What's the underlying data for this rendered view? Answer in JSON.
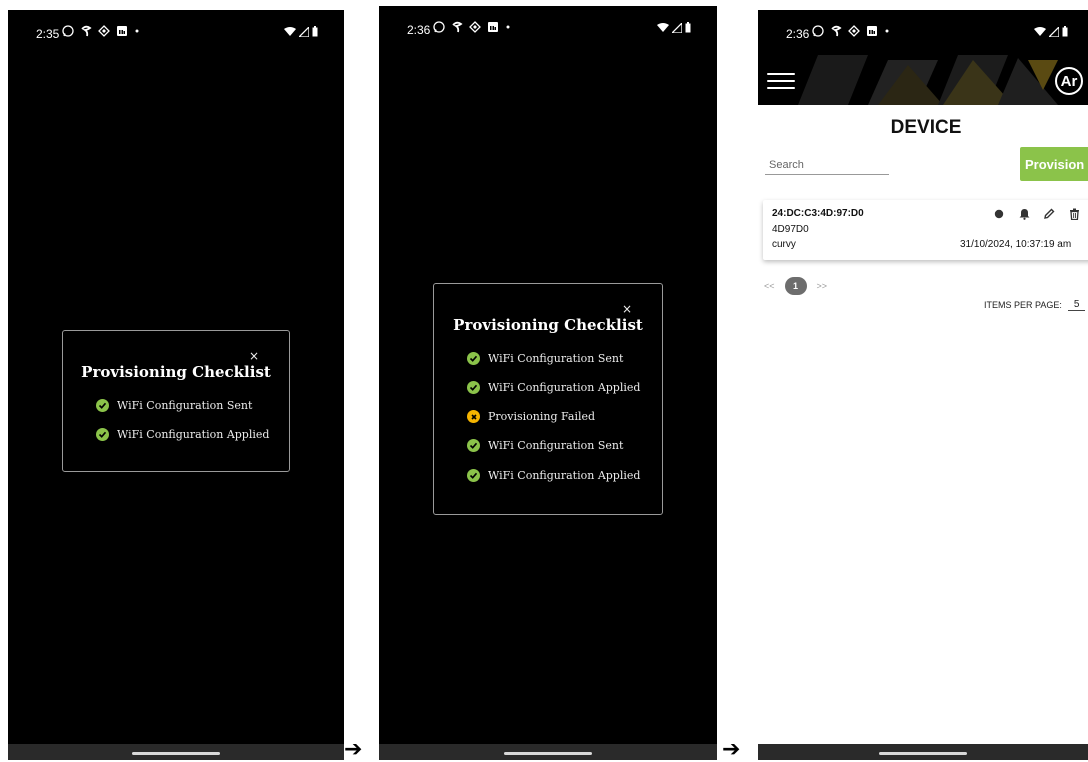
{
  "screens": [
    {
      "status_time": "2:35",
      "dialog": {
        "title": "Provisioning Checklist",
        "close": "×",
        "items": [
          {
            "label": "WiFi Configuration Sent",
            "status": "success"
          },
          {
            "label": "WiFi Configuration Applied",
            "status": "success"
          }
        ]
      }
    },
    {
      "status_time": "2:36",
      "dialog": {
        "title": "Provisioning Checklist",
        "close": "×",
        "items": [
          {
            "label": "WiFi Configuration Sent",
            "status": "success"
          },
          {
            "label": "WiFi Configuration Applied",
            "status": "success"
          },
          {
            "label": "Provisioning Failed",
            "status": "failed"
          },
          {
            "label": "WiFi Configuration Sent",
            "status": "success"
          },
          {
            "label": "WiFi Configuration Applied",
            "status": "success"
          }
        ]
      }
    },
    {
      "status_time": "2:36",
      "avatar": "Ar",
      "page_title": "DEVICE",
      "search_placeholder": "Search",
      "provision_label": "Provision",
      "device": {
        "mac": "24:DC:C3:4D:97:D0",
        "short_id": "4D97D0",
        "name": "curvy",
        "timestamp": "31/10/2024, 10:37:19 am"
      },
      "pagination": {
        "prev": "<<",
        "current": "1",
        "next": ">>"
      },
      "items_per_page_label": "ITEMS PER PAGE:",
      "items_per_page_value": "5"
    }
  ],
  "arrows": [
    "➔",
    "➔"
  ],
  "colors": {
    "success": "#8bc34a",
    "failed": "#f5b400",
    "accent": "#8bc34a"
  }
}
